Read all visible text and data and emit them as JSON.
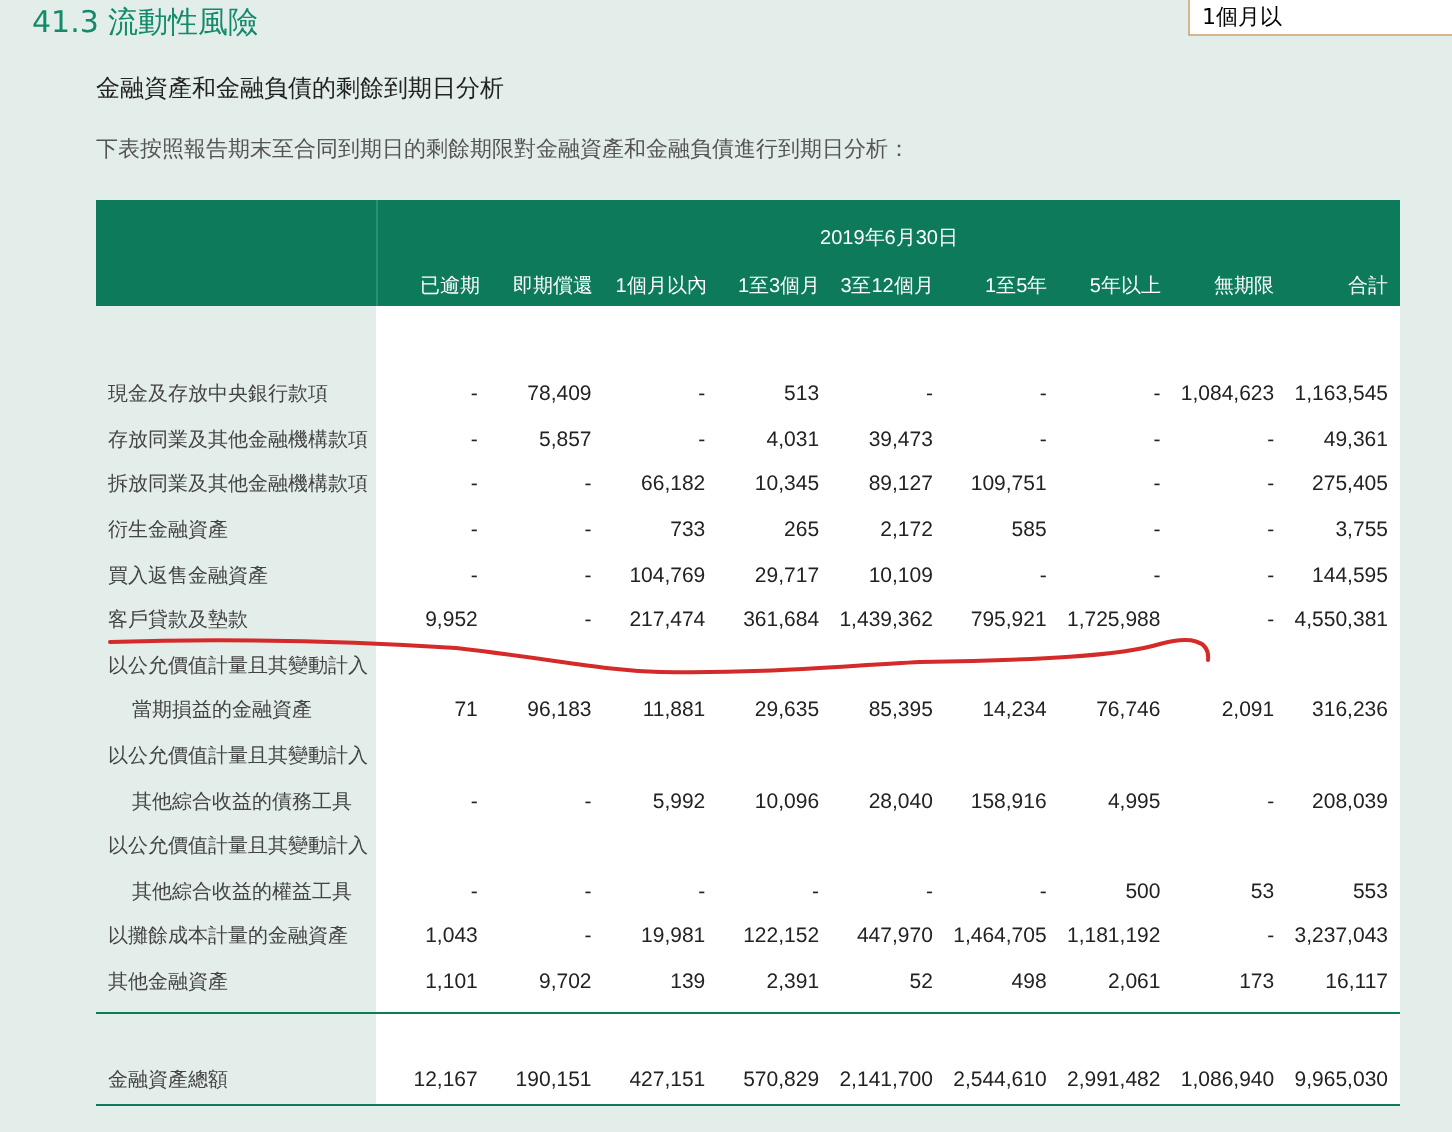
{
  "search": {
    "value": "1個月以"
  },
  "section_title": "41.3 流動性風險",
  "subtitle": "金融資產和金融負債的剩餘到期日分析",
  "intro": "下表按照報告期末至合同到期日的剩餘期限對金融資產和金融負債進行到期日分析：",
  "table": {
    "date_header": "2019年6月30日",
    "columns": [
      "已逾期",
      "即期償還",
      "1個月以內",
      "1至3個月",
      "3至12個月",
      "1至5年",
      "5年以上",
      "無期限",
      "合計"
    ],
    "rows": [
      {
        "kind": "item",
        "label": "現金及存放中央銀行款項",
        "values": [
          "-",
          "78,409",
          "-",
          "513",
          "-",
          "-",
          "-",
          "1,084,623",
          "1,163,545"
        ]
      },
      {
        "kind": "item",
        "label": "存放同業及其他金融機構款項",
        "values": [
          "-",
          "5,857",
          "-",
          "4,031",
          "39,473",
          "-",
          "-",
          "-",
          "49,361"
        ]
      },
      {
        "kind": "item",
        "label": "拆放同業及其他金融機構款項",
        "values": [
          "-",
          "-",
          "66,182",
          "10,345",
          "89,127",
          "109,751",
          "-",
          "-",
          "275,405"
        ]
      },
      {
        "kind": "item",
        "label": "衍生金融資產",
        "values": [
          "-",
          "-",
          "733",
          "265",
          "2,172",
          "585",
          "-",
          "-",
          "3,755"
        ]
      },
      {
        "kind": "item",
        "label": "買入返售金融資產",
        "values": [
          "-",
          "-",
          "104,769",
          "29,717",
          "10,109",
          "-",
          "-",
          "-",
          "144,595"
        ]
      },
      {
        "kind": "item",
        "label": "客戶貸款及墊款",
        "values": [
          "9,952",
          "-",
          "217,474",
          "361,684",
          "1,439,362",
          "795,921",
          "1,725,988",
          "-",
          "4,550,381"
        ]
      },
      {
        "kind": "heading",
        "label": "以公允價值計量且其變動計入"
      },
      {
        "kind": "subitem",
        "label": "當期損益的金融資產",
        "values": [
          "71",
          "96,183",
          "11,881",
          "29,635",
          "85,395",
          "14,234",
          "76,746",
          "2,091",
          "316,236"
        ]
      },
      {
        "kind": "heading",
        "label": "以公允價值計量且其變動計入"
      },
      {
        "kind": "subitem",
        "label": "其他綜合收益的債務工具",
        "values": [
          "-",
          "-",
          "5,992",
          "10,096",
          "28,040",
          "158,916",
          "4,995",
          "-",
          "208,039"
        ]
      },
      {
        "kind": "heading",
        "label": "以公允價值計量且其變動計入"
      },
      {
        "kind": "subitem",
        "label": "其他綜合收益的權益工具",
        "values": [
          "-",
          "-",
          "-",
          "-",
          "-",
          "-",
          "500",
          "53",
          "553"
        ]
      },
      {
        "kind": "item",
        "label": "以攤餘成本計量的金融資產",
        "values": [
          "1,043",
          "-",
          "19,981",
          "122,152",
          "447,970",
          "1,464,705",
          "1,181,192",
          "-",
          "3,237,043"
        ]
      },
      {
        "kind": "item",
        "label": "其他金融資產",
        "values": [
          "1,101",
          "9,702",
          "139",
          "2,391",
          "52",
          "498",
          "2,061",
          "173",
          "16,117"
        ]
      }
    ],
    "total": {
      "label": "金融資產總額",
      "values": [
        "12,167",
        "190,151",
        "427,151",
        "570,829",
        "2,141,700",
        "2,544,610",
        "2,991,482",
        "1,086,940",
        "9,965,030"
      ]
    }
  }
}
